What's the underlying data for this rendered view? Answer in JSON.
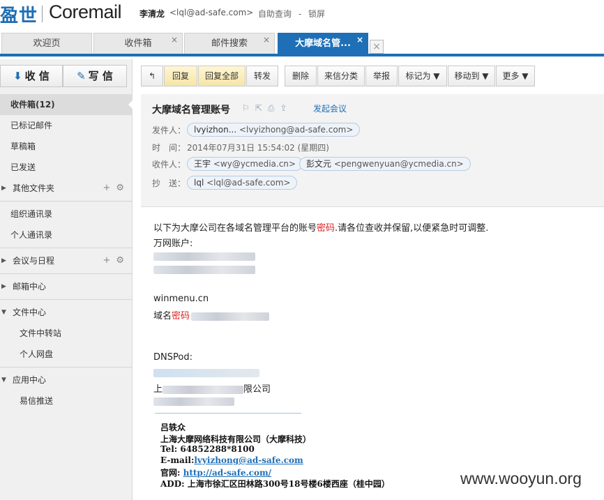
{
  "header": {
    "brand_cn": "盈世",
    "brand_en": "Coremail",
    "user_name": "李清龙",
    "user_email": "<lql@ad-safe.com>",
    "links": [
      "自助查询",
      "-",
      "锁屏"
    ]
  },
  "tabs": [
    {
      "label": "欢迎页",
      "close": ""
    },
    {
      "label": "收件箱",
      "close": "×"
    },
    {
      "label": "邮件搜索",
      "close": "×"
    },
    {
      "label": "大摩域名管...",
      "close": "×"
    }
  ],
  "sidebar": {
    "receive_label": "收 信",
    "write_label": "写 信",
    "items": [
      {
        "label": "收件箱(12)"
      },
      {
        "label": "已标记邮件"
      },
      {
        "label": "草稿箱"
      },
      {
        "label": "已发送"
      },
      {
        "label": "其他文件夹"
      },
      {
        "label": "组织通讯录"
      },
      {
        "label": "个人通讯录"
      },
      {
        "label": "会议与日程"
      },
      {
        "label": "邮箱中心"
      },
      {
        "label": "文件中心"
      },
      {
        "label": "文件中转站"
      },
      {
        "label": "个人网盘"
      },
      {
        "label": "应用中心"
      },
      {
        "label": "易信推送"
      }
    ]
  },
  "toolbar": {
    "back": "↰",
    "reply": "回复",
    "reply_all": "回复全部",
    "forward": "转发",
    "delete": "删除",
    "sort": "来信分类",
    "report": "举报",
    "mark_as": "标记为 ▼",
    "move_to": "移动到 ▼",
    "more": "更多 ▼"
  },
  "mail": {
    "subject": "大摩域名管理账号",
    "meeting": "发起会议",
    "from_label": "发件人：",
    "from_name": "lvyizhon...",
    "from_email": "<lvyizhong@ad-safe.com>",
    "time_label": "时　间：",
    "time_value": "2014年07月31日 15:54:02 (星期四)",
    "to_label": "收件人：",
    "to1_name": "王宇",
    "to1_email": "<wy@ycmedia.cn>",
    "to2_name": "彭文元",
    "to2_email": "<pengwenyuan@ycmedia.cn>",
    "cc_label": "抄　送：",
    "cc_name": "lql",
    "cc_email": "<lql@ad-safe.com>"
  },
  "body": {
    "intro_pre": "以下为大摩公司在各域名管理平台的账号",
    "intro_red": "密码",
    "intro_post": ".请各位查收并保留,以便紧急时可调整.",
    "wanwang": "万网账户:",
    "winmenu": "winmenu.cn",
    "domain_pre": "域名",
    "domain_red": "密码",
    "dnspod": "DNSPod:",
    "company_prefix": "上",
    "company_suffix": "限公司"
  },
  "signature": {
    "name": "吕轶众",
    "company": "上海大摩网络科技有限公司（大摩科技）",
    "tel": "Tel: 64852288*8100",
    "email_label": "E-mail:",
    "email": "lvyizhong@ad-safe.com",
    "site_label": "官网:",
    "site": "http://ad-safe.com/",
    "addr": "ADD: 上海市徐汇区田林路300号18号楼6楼西座（桂中园）"
  },
  "watermark": "www.wooyun.org",
  "colors": {
    "accent": "#1e6fb6",
    "highlight": "#d22"
  }
}
